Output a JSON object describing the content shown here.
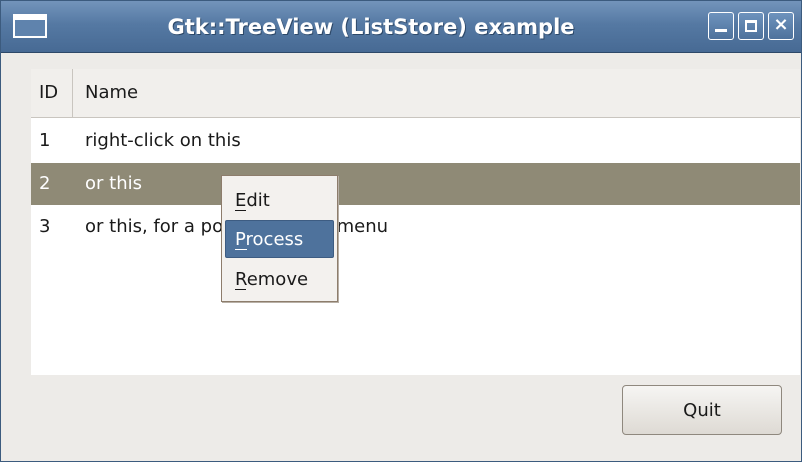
{
  "window": {
    "title": "Gtk::TreeView (ListStore) example",
    "title_bar_color": "#5579a3",
    "app_icon": "window-icon",
    "controls": {
      "minimize_icon": "minimize-icon",
      "maximize_icon": "maximize-icon",
      "close_icon": "close-icon",
      "close_glyph": "×"
    }
  },
  "tree": {
    "columns": [
      "ID",
      "Name"
    ],
    "rows": [
      {
        "id": "1",
        "name": "right-click on this",
        "selected": false
      },
      {
        "id": "2",
        "name": "or this",
        "selected": true
      },
      {
        "id": "3",
        "name": "or this, for a popup context menu",
        "selected": false
      }
    ],
    "selection_color": "#8f8a76"
  },
  "context_menu": {
    "items": [
      {
        "label": "Edit",
        "mnemonic": "E",
        "highlighted": false
      },
      {
        "label": "Process",
        "mnemonic": "P",
        "highlighted": true
      },
      {
        "label": "Remove",
        "mnemonic": "R",
        "highlighted": false
      }
    ],
    "highlight_color": "#4e729c"
  },
  "buttons": {
    "quit_label": "Quit"
  }
}
